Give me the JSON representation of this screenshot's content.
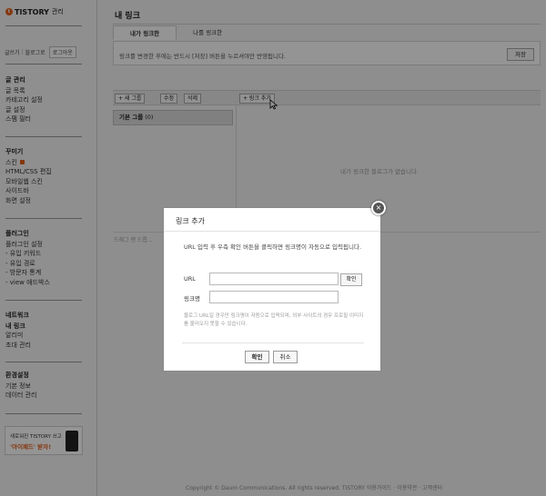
{
  "sidebar": {
    "logo_text": "TISTORY",
    "logo_sub": "관리",
    "top_links": [
      "글쓰기",
      "블로그로"
    ],
    "logout_label": "로그아웃",
    "sections": [
      {
        "heading": "글 관리",
        "items": [
          "글 목록",
          "카테고리 설정",
          "글 설정",
          "스팸 필터"
        ]
      },
      {
        "heading": "꾸미기",
        "items": [
          "스킨",
          "HTML/CSS 편집",
          "모바일웹 스킨",
          "사이드바",
          "화면 설정"
        ]
      },
      {
        "heading": "플러그인",
        "items": [
          "플러그인 설정",
          "- 유입 키워드",
          "- 유입 경로",
          "- 방문자 통계",
          "- view 애드박스"
        ]
      },
      {
        "heading": "네트워크",
        "items": [
          "내 링크",
          "알리미",
          "초대 관리"
        ]
      },
      {
        "heading": "환경설정",
        "items": [
          "기본 정보",
          "데이터 관리"
        ]
      }
    ],
    "banner": {
      "line1": "새로워진 TISTORY 쓰고",
      "line2": "'아이패드' 받자!"
    }
  },
  "main": {
    "page_title": "내 링크",
    "tabs": [
      "내가 링크한",
      "나를 링크한"
    ],
    "notice_text": "링크를 변경한 후에는 반드시 [저장] 버튼을 누르셔야만 반영됩니다.",
    "save_label": "저장",
    "toolbar": {
      "new_group": "+ 새 그룹",
      "edit": "수정",
      "delete": "삭제",
      "add_link": "+ 링크 추가"
    },
    "groups": [
      {
        "name": "기본 그룹",
        "count": "(0)"
      }
    ],
    "empty_message": "내가 링크한 블로그가 없습니다.",
    "footer_hint": "드래그 앤 드롭...",
    "copyright": "Copyright © Daum Communications. All rights reserved. TISTORY  이용가이드  ·  이용약관  ·  고객센터"
  },
  "modal": {
    "title": "링크 추가",
    "description": "URL 입력 후 우측 확인 버튼을 클릭하면 링크명이 자동으로 입력됩니다.",
    "url_label": "URL",
    "url_value": "",
    "check_label": "확인",
    "name_label": "링크명",
    "name_value": "",
    "note": "블로그 URL일 경우만 링크명이 자동으로 입력되며, 외부 사이트의 경우 프로필 이미지를 불러오지 못할 수 있습니다.",
    "confirm_label": "확인",
    "cancel_label": "취소",
    "close_symbol": "×"
  },
  "colors": {
    "accent": "#e55f1a",
    "overlay": "rgba(0,0,0,0.42)"
  }
}
